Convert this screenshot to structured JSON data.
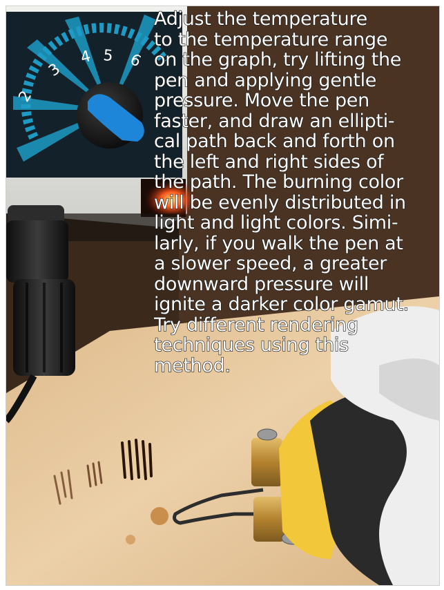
{
  "image": {
    "subject": "wood-burning-pen-demonstration",
    "dial_numbers": [
      "2",
      "3",
      "4",
      "5",
      "6"
    ],
    "colors": {
      "dial_face": "#13212a",
      "dial_accent": "#1d9bc4",
      "knob": "#1e86d8",
      "device_body": "#e9e9e6",
      "wood": "#e6c79e",
      "pen_grip": "#2a2a2a",
      "pen_collar": "#f2c73a",
      "brass": "#b98a3a",
      "glove": "#eeeeee",
      "caption_fill": "#ffffff",
      "caption_outline": "#161616"
    }
  },
  "caption": {
    "lines": [
      "Adjust the temperature",
      "to the temperature range",
      "on the graph, try lifting the",
      "pen and applying gentle",
      "pressure. Move the pen",
      "faster, and draw an ellipti-",
      "cal path back and forth on",
      "the left and right sides of",
      "the path. The burning color",
      "will be evenly distributed in",
      "light and light colors. Simi-",
      "larly, if you walk the pen at",
      "a slower speed, a greater",
      "downward pressure will",
      "ignite a darker color gamut.",
      "Try different rendering",
      "techniques using this",
      "method."
    ]
  }
}
